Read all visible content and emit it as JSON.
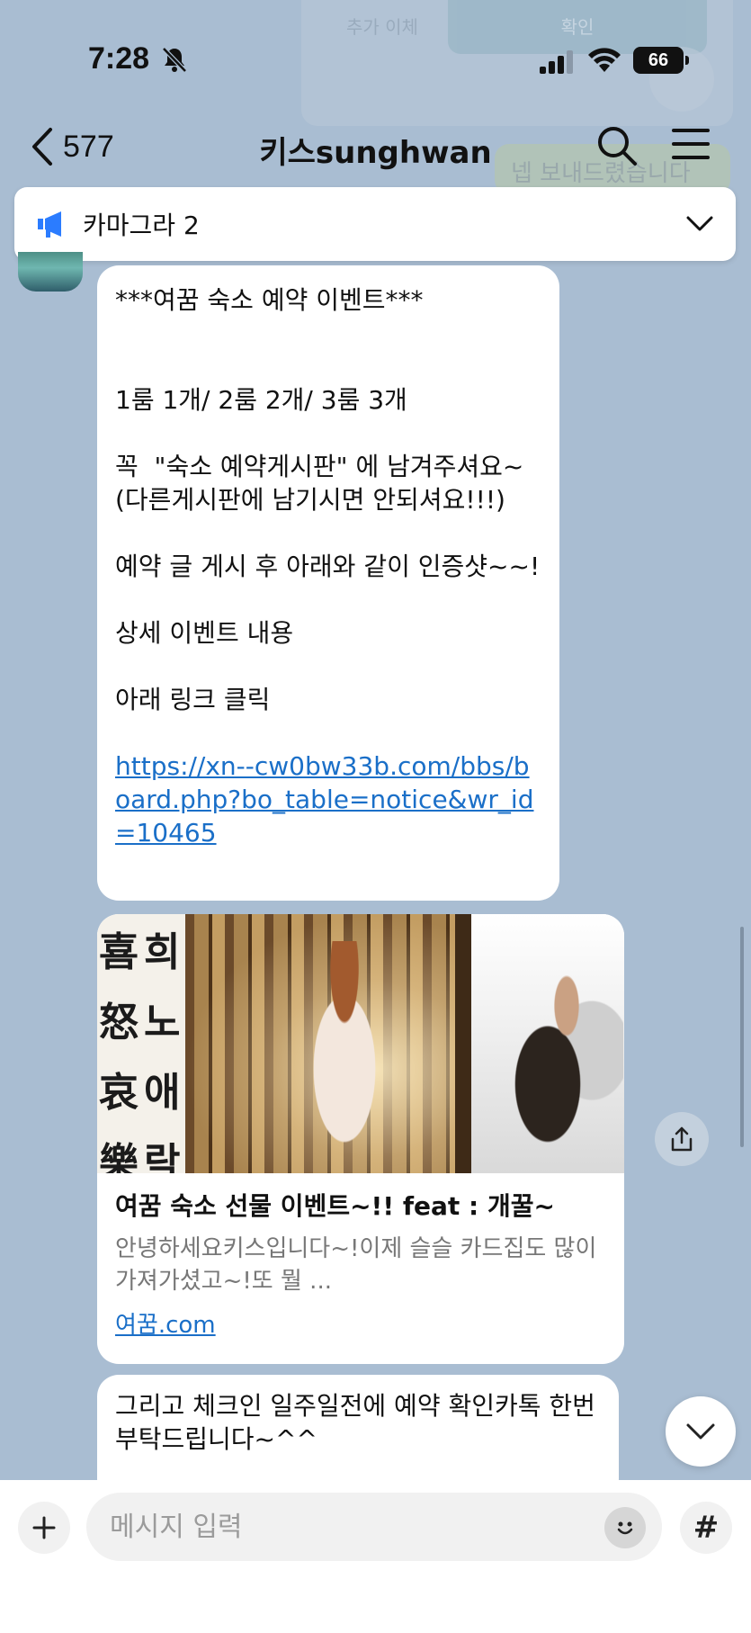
{
  "ghost": {
    "add_label": "추가 이체",
    "ok_label": "확인",
    "bubble_text": "넵 보내드렸습니다"
  },
  "status_bar": {
    "time": "7:28",
    "battery": "66"
  },
  "header": {
    "back_count": "577",
    "title": "키스sunghwan"
  },
  "notice": {
    "text": "카마그라 2"
  },
  "messages": {
    "event": {
      "line1": "***여꿈 숙소 예약 이벤트***",
      "line2": "1룸 1개/ 2룸 2개/ 3룸 3개",
      "line3": "꼭  \"숙소 예약게시판\" 에 남겨주셔요~\n(다른게시판에 남기시면 안되셔요!!!)",
      "line4": "예약 글 게시 후 아래와 같이 인증샷~~!",
      "line5": "상세 이벤트 내용",
      "line6": "아래 링크 클릭",
      "link": "https://xn--cw0bw33b.com/bbs/board.php?bo_table=notice&wr_id=10465"
    },
    "card": {
      "callig_col1": [
        "희",
        "노",
        "애",
        "락"
      ],
      "callig_col2": [
        "喜",
        "怒",
        "哀",
        "樂"
      ],
      "title": "여꿈 숙소 선물 이벤트~!! feat : 개꿀~",
      "description": "안녕하세요키스입니다~!이제 슬슬 카드집도 많이 가져가셨고~!또 뭘 ...",
      "domain": "여꿈.com"
    },
    "checkin": {
      "text": "그리고 체크인 일주일전에 예약 확인카톡 한번 부탁드립니다~^^"
    }
  },
  "input_bar": {
    "placeholder": "메시지 입력",
    "hash": "#"
  },
  "colors": {
    "background": "#a9bdd2",
    "link": "#1a6fc8",
    "notice_icon": "#2b7cff"
  },
  "icons": [
    "bell-off-icon",
    "signal-icon",
    "wifi-icon",
    "back-chevron-icon",
    "search-icon",
    "menu-icon",
    "megaphone-icon",
    "chevron-down-icon",
    "share-icon",
    "plus-icon",
    "emoji-icon",
    "hash-icon"
  ]
}
